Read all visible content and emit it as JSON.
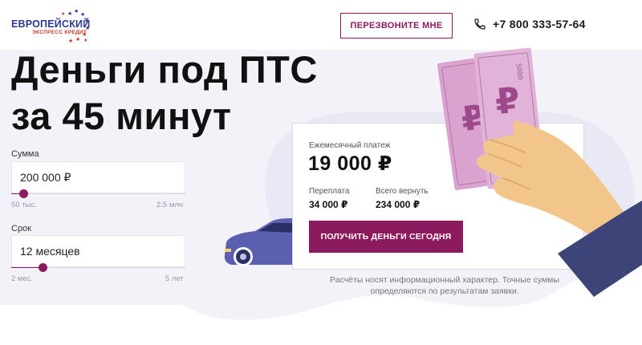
{
  "header": {
    "logo_line1": "ЕВРОПЕЙСКИЙ",
    "logo_line2": "ЭКСПРЕСС КРЕДИТ",
    "callback_label": "ПЕРЕЗВОНИТЕ МНЕ",
    "phone": "+7 800 333-57-64"
  },
  "hero": {
    "title": "Деньги под ПТС\nза 45 минут"
  },
  "amount": {
    "label": "Сумма",
    "value": "200 000 ₽",
    "min": "50 тыс.",
    "max": "2.5 млн",
    "position": 0.07
  },
  "term": {
    "label": "Срок",
    "value": "12 месяцев",
    "min": "2 мес.",
    "max": "5 лет",
    "position": 0.18
  },
  "card": {
    "monthly_label": "Ежемесячный платеж",
    "monthly_value": "19 000 ₽",
    "overpay_label": "Переплата",
    "overpay_value": "34 000 ₽",
    "total_label": "Всего вернуть",
    "total_value": "234 000 ₽",
    "cta_label": "ПОЛУЧИТЬ ДЕНЬГИ СЕГОДНЯ"
  },
  "disclaimer": "Расчёты носят информационный характер. Точные суммы определяются по результатам заявки.",
  "colors": {
    "accent": "#8c1a5f",
    "brand_blue": "#2c3a8c",
    "background_blob": "#f1f0f8",
    "banknote": "#d9a2cf"
  },
  "icons": {
    "phone": "phone-icon",
    "logo": "eu-stars-logo"
  }
}
